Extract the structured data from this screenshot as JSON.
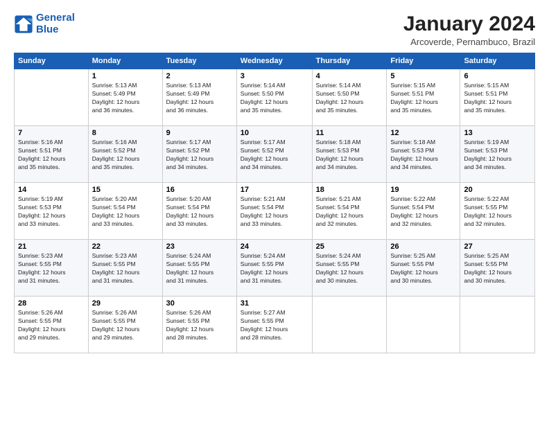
{
  "logo": {
    "line1": "General",
    "line2": "Blue"
  },
  "title": "January 2024",
  "location": "Arcoverde, Pernambuco, Brazil",
  "days_of_week": [
    "Sunday",
    "Monday",
    "Tuesday",
    "Wednesday",
    "Thursday",
    "Friday",
    "Saturday"
  ],
  "weeks": [
    [
      {
        "day": "",
        "info": ""
      },
      {
        "day": "1",
        "info": "Sunrise: 5:13 AM\nSunset: 5:49 PM\nDaylight: 12 hours\nand 36 minutes."
      },
      {
        "day": "2",
        "info": "Sunrise: 5:13 AM\nSunset: 5:49 PM\nDaylight: 12 hours\nand 36 minutes."
      },
      {
        "day": "3",
        "info": "Sunrise: 5:14 AM\nSunset: 5:50 PM\nDaylight: 12 hours\nand 35 minutes."
      },
      {
        "day": "4",
        "info": "Sunrise: 5:14 AM\nSunset: 5:50 PM\nDaylight: 12 hours\nand 35 minutes."
      },
      {
        "day": "5",
        "info": "Sunrise: 5:15 AM\nSunset: 5:51 PM\nDaylight: 12 hours\nand 35 minutes."
      },
      {
        "day": "6",
        "info": "Sunrise: 5:15 AM\nSunset: 5:51 PM\nDaylight: 12 hours\nand 35 minutes."
      }
    ],
    [
      {
        "day": "7",
        "info": "Sunrise: 5:16 AM\nSunset: 5:51 PM\nDaylight: 12 hours\nand 35 minutes."
      },
      {
        "day": "8",
        "info": "Sunrise: 5:16 AM\nSunset: 5:52 PM\nDaylight: 12 hours\nand 35 minutes."
      },
      {
        "day": "9",
        "info": "Sunrise: 5:17 AM\nSunset: 5:52 PM\nDaylight: 12 hours\nand 34 minutes."
      },
      {
        "day": "10",
        "info": "Sunrise: 5:17 AM\nSunset: 5:52 PM\nDaylight: 12 hours\nand 34 minutes."
      },
      {
        "day": "11",
        "info": "Sunrise: 5:18 AM\nSunset: 5:53 PM\nDaylight: 12 hours\nand 34 minutes."
      },
      {
        "day": "12",
        "info": "Sunrise: 5:18 AM\nSunset: 5:53 PM\nDaylight: 12 hours\nand 34 minutes."
      },
      {
        "day": "13",
        "info": "Sunrise: 5:19 AM\nSunset: 5:53 PM\nDaylight: 12 hours\nand 34 minutes."
      }
    ],
    [
      {
        "day": "14",
        "info": "Sunrise: 5:19 AM\nSunset: 5:53 PM\nDaylight: 12 hours\nand 33 minutes."
      },
      {
        "day": "15",
        "info": "Sunrise: 5:20 AM\nSunset: 5:54 PM\nDaylight: 12 hours\nand 33 minutes."
      },
      {
        "day": "16",
        "info": "Sunrise: 5:20 AM\nSunset: 5:54 PM\nDaylight: 12 hours\nand 33 minutes."
      },
      {
        "day": "17",
        "info": "Sunrise: 5:21 AM\nSunset: 5:54 PM\nDaylight: 12 hours\nand 33 minutes."
      },
      {
        "day": "18",
        "info": "Sunrise: 5:21 AM\nSunset: 5:54 PM\nDaylight: 12 hours\nand 32 minutes."
      },
      {
        "day": "19",
        "info": "Sunrise: 5:22 AM\nSunset: 5:54 PM\nDaylight: 12 hours\nand 32 minutes."
      },
      {
        "day": "20",
        "info": "Sunrise: 5:22 AM\nSunset: 5:55 PM\nDaylight: 12 hours\nand 32 minutes."
      }
    ],
    [
      {
        "day": "21",
        "info": "Sunrise: 5:23 AM\nSunset: 5:55 PM\nDaylight: 12 hours\nand 31 minutes."
      },
      {
        "day": "22",
        "info": "Sunrise: 5:23 AM\nSunset: 5:55 PM\nDaylight: 12 hours\nand 31 minutes."
      },
      {
        "day": "23",
        "info": "Sunrise: 5:24 AM\nSunset: 5:55 PM\nDaylight: 12 hours\nand 31 minutes."
      },
      {
        "day": "24",
        "info": "Sunrise: 5:24 AM\nSunset: 5:55 PM\nDaylight: 12 hours\nand 31 minutes."
      },
      {
        "day": "25",
        "info": "Sunrise: 5:24 AM\nSunset: 5:55 PM\nDaylight: 12 hours\nand 30 minutes."
      },
      {
        "day": "26",
        "info": "Sunrise: 5:25 AM\nSunset: 5:55 PM\nDaylight: 12 hours\nand 30 minutes."
      },
      {
        "day": "27",
        "info": "Sunrise: 5:25 AM\nSunset: 5:55 PM\nDaylight: 12 hours\nand 30 minutes."
      }
    ],
    [
      {
        "day": "28",
        "info": "Sunrise: 5:26 AM\nSunset: 5:55 PM\nDaylight: 12 hours\nand 29 minutes."
      },
      {
        "day": "29",
        "info": "Sunrise: 5:26 AM\nSunset: 5:55 PM\nDaylight: 12 hours\nand 29 minutes."
      },
      {
        "day": "30",
        "info": "Sunrise: 5:26 AM\nSunset: 5:55 PM\nDaylight: 12 hours\nand 28 minutes."
      },
      {
        "day": "31",
        "info": "Sunrise: 5:27 AM\nSunset: 5:55 PM\nDaylight: 12 hours\nand 28 minutes."
      },
      {
        "day": "",
        "info": ""
      },
      {
        "day": "",
        "info": ""
      },
      {
        "day": "",
        "info": ""
      }
    ]
  ]
}
